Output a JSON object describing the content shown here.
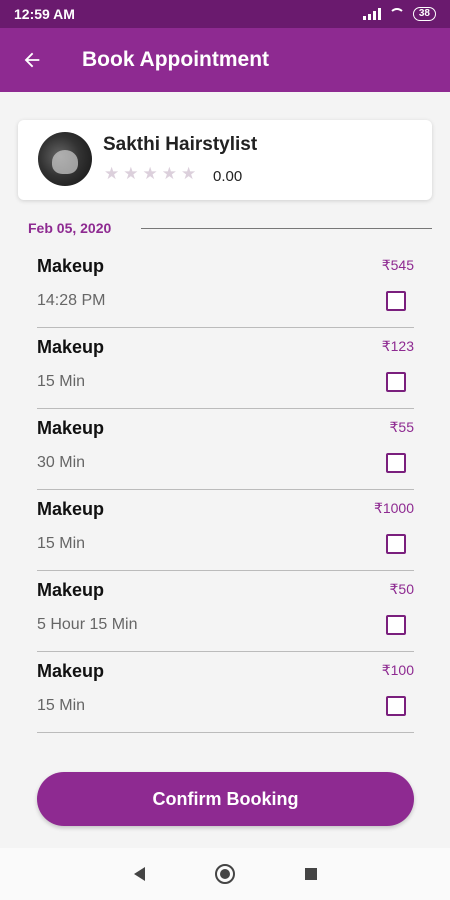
{
  "status_bar": {
    "time": "12:59 AM",
    "battery": "38"
  },
  "app_bar": {
    "title": "Book Appointment",
    "back_icon": "arrow-left-icon"
  },
  "stylist": {
    "name": "Sakthi Hairstylist",
    "rating": "0.00",
    "stars": [
      "★",
      "★",
      "★",
      "★",
      "★"
    ]
  },
  "date": "Feb 05, 2020",
  "services": [
    {
      "name": "Makeup",
      "price": "₹545",
      "duration": "14:28 PM"
    },
    {
      "name": "Makeup",
      "price": "₹123",
      "duration": "15 Min"
    },
    {
      "name": "Makeup",
      "price": "₹55",
      "duration": "30 Min"
    },
    {
      "name": "Makeup",
      "price": "₹1000",
      "duration": "15 Min"
    },
    {
      "name": "Makeup",
      "price": "₹50",
      "duration": "5 Hour 15 Min"
    },
    {
      "name": "Makeup",
      "price": "₹100",
      "duration": "15 Min"
    }
  ],
  "confirm_label": "Confirm Booking",
  "colors": {
    "primary": "#8e2a91",
    "status_bar": "#6a1a6e"
  }
}
